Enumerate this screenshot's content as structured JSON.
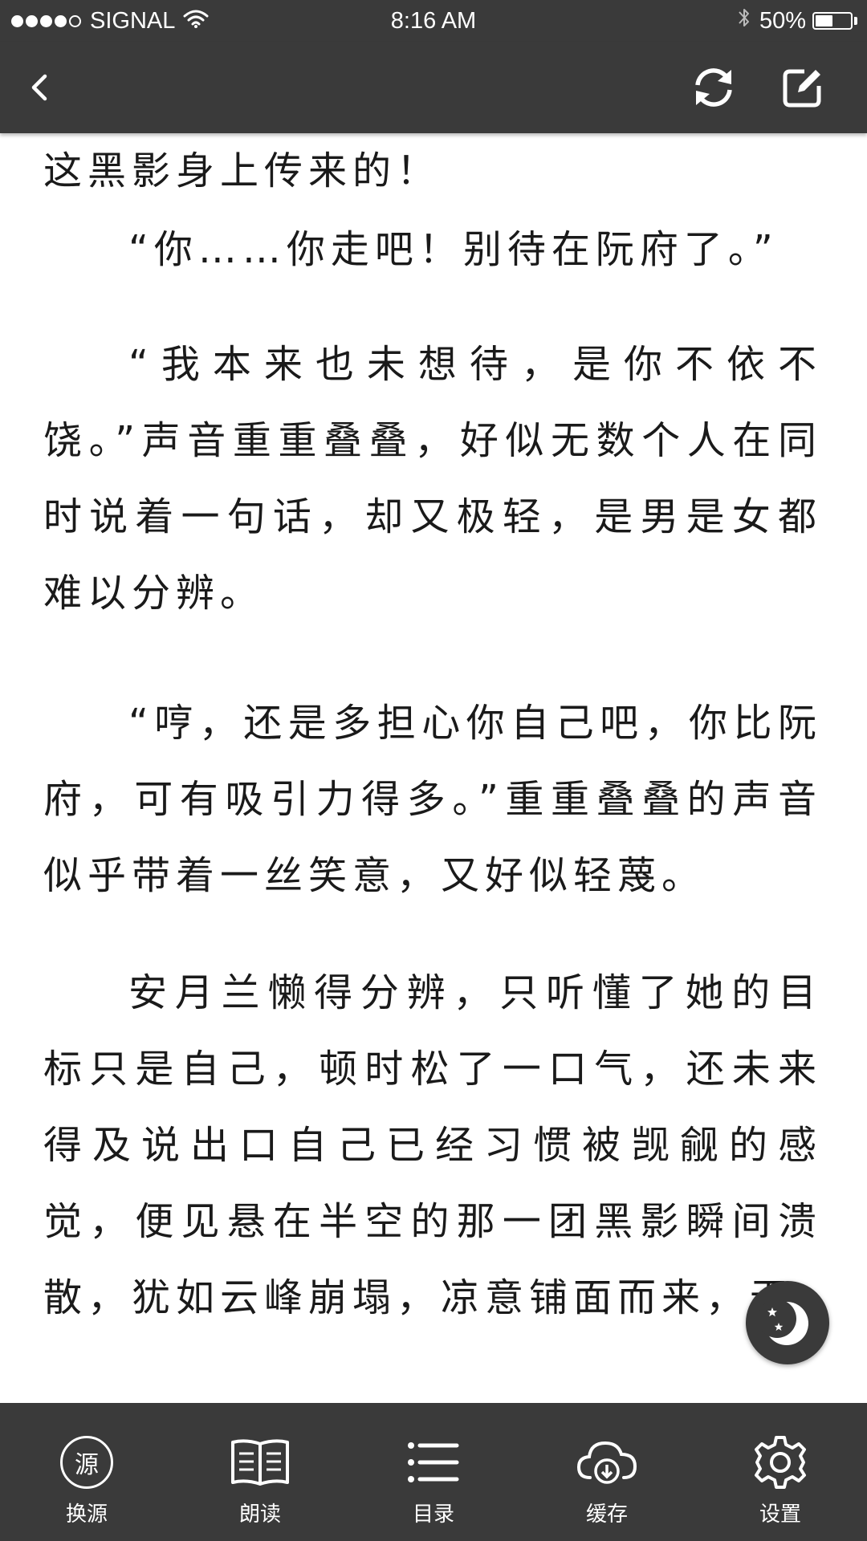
{
  "status_bar": {
    "carrier": "SIGNAL",
    "time": "8:16 AM",
    "battery_text": "50%",
    "battery_level": 0.5,
    "signal_bars_filled": 4,
    "signal_bars_total": 5
  },
  "nav": {
    "back_icon": "chevron-left-icon",
    "refresh_icon": "refresh-icon",
    "edit_icon": "edit-icon"
  },
  "content": {
    "paragraphs": [
      "这黑影身上传来的！",
      "“你……你走吧！别待在阮府了。”",
      "“我本来也未想待，是你不依不饶。”声音重重叠叠，好似无数个人在同时说着一句话，却又极轻，是男是女都难以分辨。",
      "“哼，还是多担心你自己吧，你比阮府，可有吸引力得多。”重重叠叠的声音似乎带着一丝笑意，又好似轻蔑。",
      "安月兰懒得分辨，只听懂了她的目标只是自己，顿时松了一口气，还未来得及说出口自己已经习惯被觊觎的感觉，便见悬在半空的那一团黑影瞬间溃散，犹如云峰崩塌，凉意铺面而来，无"
    ]
  },
  "night_mode": {
    "icon": "moon-stars-icon"
  },
  "toolbar": {
    "items": [
      {
        "label": "换源",
        "icon_text": "源",
        "icon": "source-icon"
      },
      {
        "label": "朗读",
        "icon": "book-open-icon"
      },
      {
        "label": "目录",
        "icon": "list-icon"
      },
      {
        "label": "缓存",
        "icon": "cloud-download-icon"
      },
      {
        "label": "设置",
        "icon": "gear-icon"
      }
    ]
  },
  "colors": {
    "bar_background": "#3a3a3a",
    "content_background": "#ffffff",
    "text": "#1a1a1a",
    "icon": "#ffffff"
  }
}
